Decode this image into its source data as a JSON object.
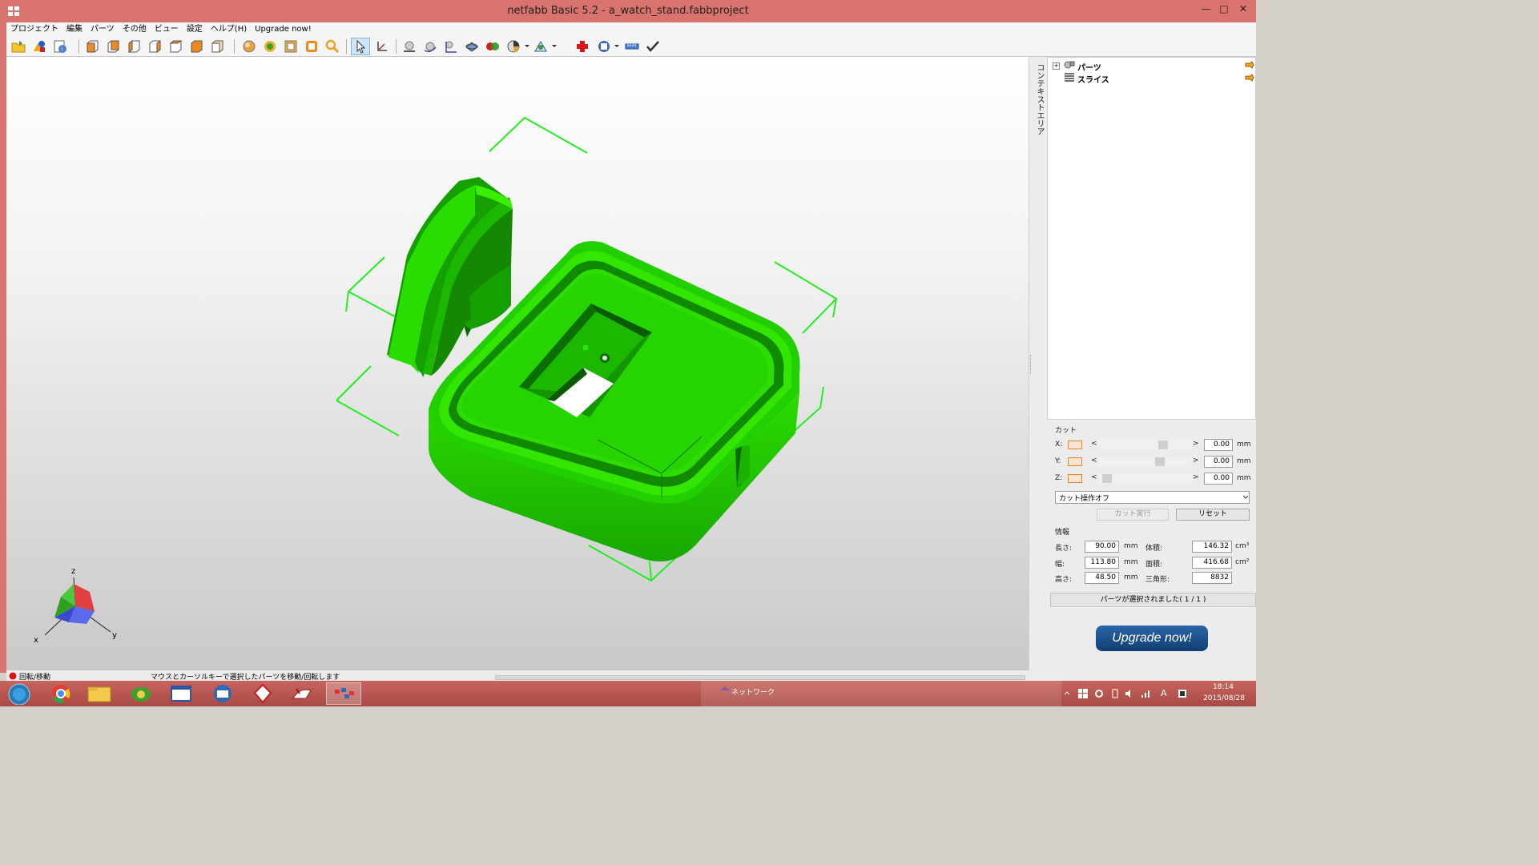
{
  "window": {
    "title": "netfabb Basic 5.2 - a_watch_stand.fabbproject",
    "minimize": "—",
    "maximize": "□",
    "close": "✕"
  },
  "menu": [
    "プロジェクト",
    "編集",
    "パーツ",
    "その他",
    "ビュー",
    "設定",
    "ヘルプ(H)",
    "Upgrade now!"
  ],
  "context_strip_label": "コンテキストエリア",
  "tree": {
    "parts_label": "パーツ",
    "slices_label": "スライス"
  },
  "cut": {
    "section_title": "カット",
    "axes": [
      {
        "axis": "X:",
        "value": "0.00",
        "unit": "mm",
        "position": 0.72
      },
      {
        "axis": "Y:",
        "value": "0.00",
        "unit": "mm",
        "position": 0.68
      },
      {
        "axis": "Z:",
        "value": "0.00",
        "unit": "mm",
        "position": 0.05
      }
    ],
    "left_arrow": "<",
    "right_arrow": ">",
    "mode_select": "カット操作オフ",
    "execute_button": "カット実行",
    "reset_button": "リセット"
  },
  "info": {
    "section_title": "情報",
    "length_label": "長さ:",
    "length_value": "90.00",
    "length_unit": "mm",
    "width_label": "幅:",
    "width_value": "113.80",
    "width_unit": "mm",
    "height_label": "高さ:",
    "height_value": "48.50",
    "height_unit": "mm",
    "volume_label": "体積:",
    "volume_value": "146.32",
    "volume_unit": "cm³",
    "area_label": "面積:",
    "area_value": "416.68",
    "area_unit": "cm²",
    "triangles_label": "三角形:",
    "triangles_value": "8832"
  },
  "selection_status": "パーツが選択されました( 1 / 1 )",
  "upgrade_button": "Upgrade now!",
  "axis_labels": {
    "z": "z",
    "x": "x",
    "y": "y"
  },
  "status": {
    "mode": "回転/移動",
    "hint": "マウスとカーソルキーで選択したパーツを移動/回転します"
  },
  "taskbar": {
    "network_label": "ネットワーク",
    "time": "18:14",
    "date": "2015/08/28",
    "ime": "A"
  },
  "colors": {
    "titlebar": "#d9736d",
    "model_green": "#22d400",
    "model_dark": "#128600",
    "bbox_green": "#22ee22",
    "upgrade_blue": "#1a4f8a"
  }
}
